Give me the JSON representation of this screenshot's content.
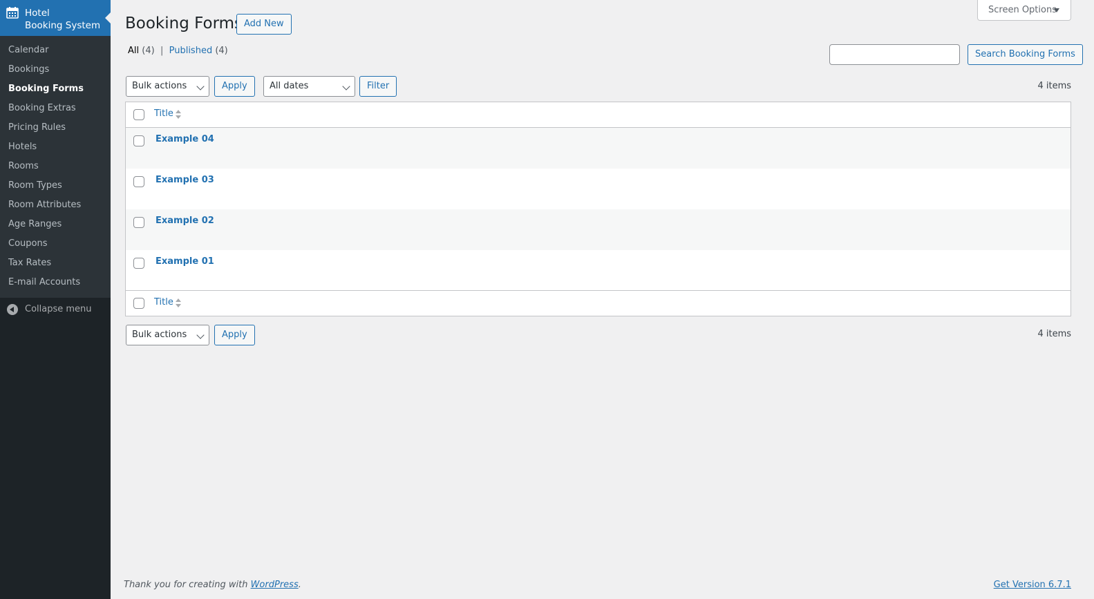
{
  "sidebar": {
    "title_line1": "Hotel",
    "title_line2": "Booking System",
    "items": [
      {
        "label": "Calendar"
      },
      {
        "label": "Bookings"
      },
      {
        "label": "Booking Forms"
      },
      {
        "label": "Booking Extras"
      },
      {
        "label": "Pricing Rules"
      },
      {
        "label": "Hotels"
      },
      {
        "label": "Rooms"
      },
      {
        "label": "Room Types"
      },
      {
        "label": "Room Attributes"
      },
      {
        "label": "Age Ranges"
      },
      {
        "label": "Coupons"
      },
      {
        "label": "Tax Rates"
      },
      {
        "label": "E-mail Accounts"
      }
    ],
    "collapse_label": "Collapse menu"
  },
  "header": {
    "title": "Booking Forms",
    "add_new": "Add New",
    "screen_options": "Screen Options"
  },
  "views": {
    "all_label": "All",
    "all_count": "(4)",
    "separator": "|",
    "published_label": "Published",
    "published_count": "(4)"
  },
  "search": {
    "value": "",
    "button": "Search Booking Forms"
  },
  "top_nav": {
    "bulk_actions": "Bulk actions",
    "apply": "Apply",
    "dates": "All dates",
    "filter": "Filter",
    "items_count": "4 items"
  },
  "table": {
    "column_title": "Title",
    "rows": [
      {
        "title": "Example 04"
      },
      {
        "title": "Example 03"
      },
      {
        "title": "Example 02"
      },
      {
        "title": "Example 01"
      }
    ]
  },
  "bottom_nav": {
    "bulk_actions": "Bulk actions",
    "apply": "Apply",
    "items_count": "4 items"
  },
  "footer": {
    "thanks_prefix": "Thank you for creating with ",
    "wp_link": "WordPress",
    "thanks_suffix": ".",
    "version_link": "Get Version 6.7.1"
  },
  "colors": {
    "accent": "#2271b1",
    "sidebar_bg": "#1d2327",
    "submenu_bg": "#2c3338",
    "page_bg": "#f0f0f1"
  }
}
